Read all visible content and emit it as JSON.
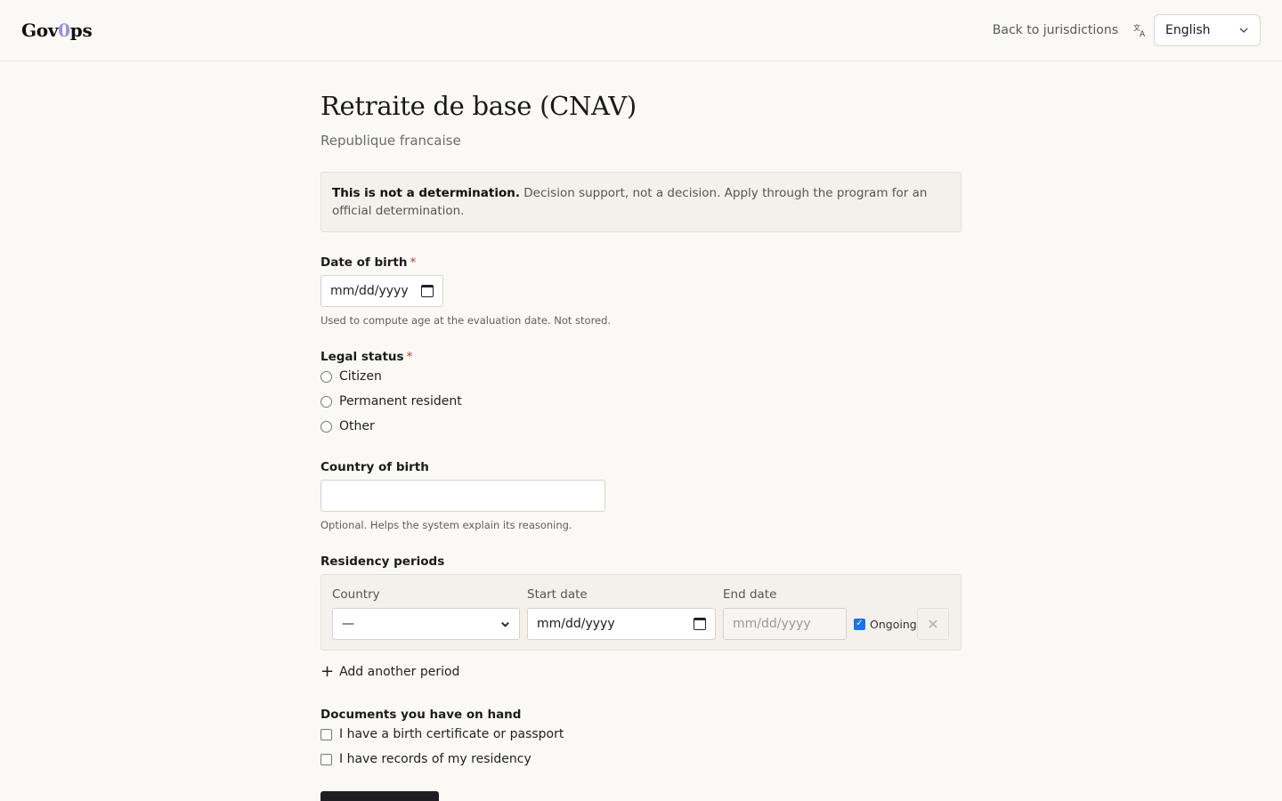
{
  "header": {
    "logo_part1": "Gov",
    "logo_accent": "0",
    "logo_part2": "ps",
    "back_link": "Back to jurisdictions",
    "language": "English",
    "language_icon": "translate-icon"
  },
  "page": {
    "title": "Retraite de base (CNAV)",
    "subtitle": "Republique francaise"
  },
  "notice": {
    "bold": "This is not a determination.",
    "text": " Decision support, not a decision. Apply through the program for an official determination."
  },
  "dob": {
    "label": "Date of birth",
    "required": "*",
    "placeholder": "mm/dd/yyyy",
    "help": "Used to compute age at the evaluation date. Not stored."
  },
  "legal_status": {
    "label": "Legal status",
    "required": "*",
    "options": [
      "Citizen",
      "Permanent resident",
      "Other"
    ]
  },
  "country_of_birth": {
    "label": "Country of birth",
    "value": "",
    "help": "Optional. Helps the system explain its reasoning."
  },
  "residency": {
    "label": "Residency periods",
    "country_label": "Country",
    "country_value": "—",
    "start_label": "Start date",
    "start_placeholder": "mm/dd/yyyy",
    "end_label": "End date",
    "end_placeholder": "mm/dd/yyyy",
    "ongoing_label": "Ongoing",
    "ongoing_checked": true,
    "add_label": "Add another period"
  },
  "documents": {
    "label": "Documents you have on hand",
    "options": [
      "I have a birth certificate or passport",
      "I have records of my residency"
    ]
  },
  "colors": {
    "accent_logo": "#9c8ee6",
    "required_mark": "#c0392b",
    "checkbox_on": "#1a73e8"
  }
}
